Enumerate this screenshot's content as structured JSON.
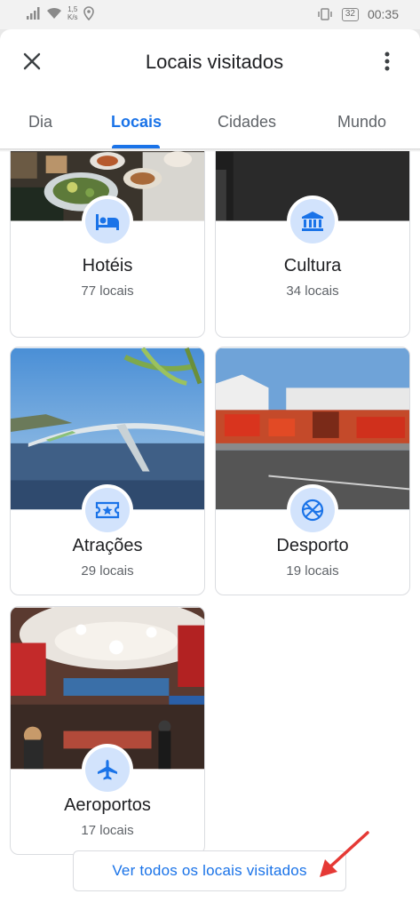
{
  "status_bar": {
    "net_speed_value": "1,5",
    "net_speed_unit": "K/s",
    "battery": "32",
    "time": "00:35"
  },
  "app_bar": {
    "title": "Locais visitados"
  },
  "tabs": [
    {
      "label": "Dia",
      "active": false
    },
    {
      "label": "Locais",
      "active": true
    },
    {
      "label": "Cidades",
      "active": false
    },
    {
      "label": "Mundo",
      "active": false
    }
  ],
  "categories": [
    {
      "name": "Hotéis",
      "count": "77 locais",
      "icon": "bed-icon"
    },
    {
      "name": "Cultura",
      "count": "34 locais",
      "icon": "museum-icon"
    },
    {
      "name": "Atrações",
      "count": "29 locais",
      "icon": "ticket-icon"
    },
    {
      "name": "Desporto",
      "count": "19 locais",
      "icon": "basketball-icon"
    },
    {
      "name": "Aeroportos",
      "count": "17 locais",
      "icon": "airplane-icon"
    }
  ],
  "view_all_label": "Ver todos os locais visitados",
  "colors": {
    "accent": "#1a73e8",
    "icon_bg": "#d2e3fc",
    "annotation_arrow": "#e53935"
  }
}
